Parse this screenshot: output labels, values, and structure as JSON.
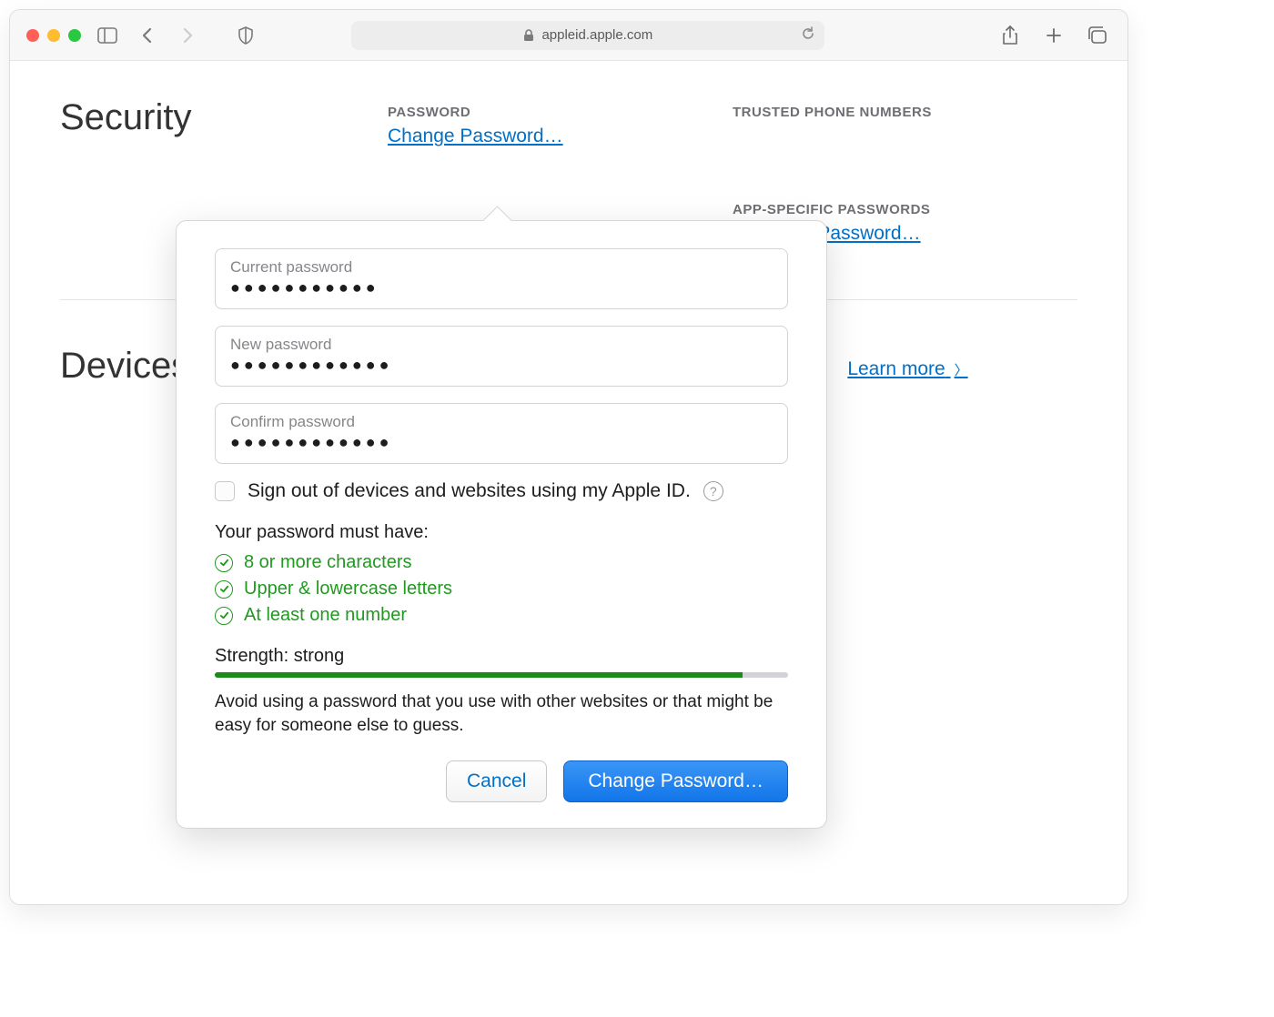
{
  "browser": {
    "url": "appleid.apple.com"
  },
  "page": {
    "security_heading": "Security",
    "devices_heading": "Devices",
    "learn_more": "Learn more",
    "password_section": {
      "label": "PASSWORD",
      "link": "Change Password…"
    },
    "trusted_section": {
      "label": "TRUSTED PHONE NUMBERS"
    },
    "app_specific_section": {
      "label": "APP-SPECIFIC PASSWORDS",
      "link": "Generate Password…"
    }
  },
  "popover": {
    "fields": {
      "current": {
        "label": "Current password",
        "masked": "●●●●●●●●●●●"
      },
      "new": {
        "label": "New password",
        "masked": "●●●●●●●●●●●●"
      },
      "confirm": {
        "label": "Confirm password",
        "masked": "●●●●●●●●●●●●"
      }
    },
    "signout_label": "Sign out of devices and websites using my Apple ID.",
    "requirements_title": "Your password must have:",
    "requirements": {
      "r1": "8 or more characters",
      "r2": "Upper & lowercase letters",
      "r3": "At least one number"
    },
    "strength_label": "Strength: strong",
    "strength_percent": "92",
    "advice": "Avoid using a password that you use with other websites or that might be easy for someone else to guess.",
    "cancel": "Cancel",
    "submit": "Change Password…"
  }
}
